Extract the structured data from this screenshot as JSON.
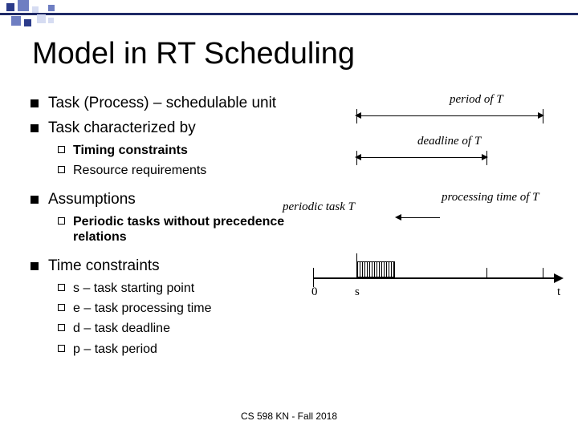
{
  "title": "Model in RT Scheduling",
  "bullets": {
    "task_process": "Task (Process)  – schedulable unit",
    "task_char": "Task characterized by",
    "timing_constraints": "Timing constraints",
    "resource_req": "Resource requirements",
    "assumptions": "Assumptions",
    "periodic_tasks": "Periodic tasks without precedence relations",
    "time_constraints": "Time constraints",
    "s": "s – task starting point",
    "e": "e – task processing time",
    "d": "d – task deadline",
    "p": "p – task period"
  },
  "diagram": {
    "period_label": "period of T",
    "deadline_label": "deadline of T",
    "task_label": "periodic task T",
    "processing_label": "processing time of T",
    "axis_origin": "0",
    "axis_s": "s",
    "axis_t": "t"
  },
  "footer": "CS 598 KN - Fall 2018"
}
